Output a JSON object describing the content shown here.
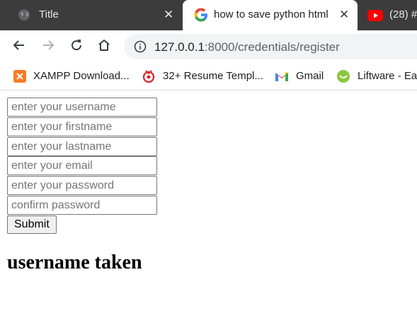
{
  "browser": {
    "tabs": [
      {
        "title": "Title",
        "icon": "globe-icon",
        "active": false
      },
      {
        "title": "how to save python html",
        "icon": "google-icon",
        "active": true
      },
      {
        "title": "(28) #",
        "icon": "youtube-icon",
        "active": false
      }
    ],
    "toolbar": {
      "url_host": "127.0.0.1",
      "url_path": ":8000/credentials/register"
    },
    "bookmarks": [
      {
        "label": "XAMPP Download...",
        "icon": "xampp-icon"
      },
      {
        "label": "32+ Resume Templ...",
        "icon": "resume-icon"
      },
      {
        "label": "Gmail",
        "icon": "gmail-icon"
      },
      {
        "label": "Liftware - Ea",
        "icon": "liftware-icon"
      }
    ]
  },
  "form": {
    "fields": [
      {
        "placeholder": "enter your username",
        "value": ""
      },
      {
        "placeholder": "enter your firstname",
        "value": ""
      },
      {
        "placeholder": "enter your lastname",
        "value": ""
      },
      {
        "placeholder": "enter your email",
        "value": ""
      },
      {
        "placeholder": "enter your password",
        "value": ""
      },
      {
        "placeholder": "confirm password",
        "value": ""
      }
    ],
    "submit_label": "Submit"
  },
  "message": "username taken",
  "colors": {
    "tabstrip_bg": "#3c3c3c",
    "active_tab_bg": "#ffffff",
    "omnibox_bg": "#f1f3f4",
    "youtube_red": "#ff0000",
    "gmail_red": "#ea4335",
    "xampp_orange": "#fb7a24",
    "liftware_green": "#8cc63f"
  }
}
